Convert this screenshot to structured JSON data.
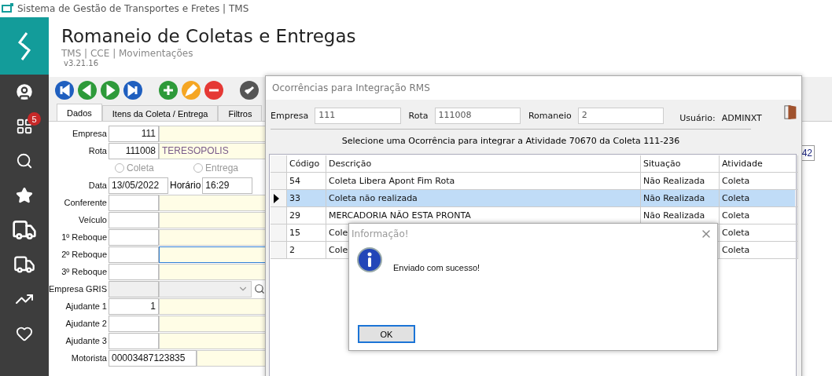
{
  "app_title": "Sistema de Gestão de Transportes e Fretes | TMS",
  "sidebar": {
    "items": [
      {
        "kind": "user"
      },
      {
        "kind": "grid",
        "badge": "5"
      },
      {
        "kind": "search"
      },
      {
        "kind": "star"
      },
      {
        "kind": "truck"
      },
      {
        "kind": "van"
      },
      {
        "kind": "chart"
      },
      {
        "kind": "heart"
      }
    ]
  },
  "header": {
    "title": "Romaneio de Coletas e Entregas",
    "breadcrumb": "TMS | CCE | Movimentações",
    "version": "v3.21.16"
  },
  "toolbar": {
    "buttons": [
      {
        "kind": "first"
      },
      {
        "kind": "prev"
      },
      {
        "kind": "next"
      },
      {
        "kind": "last"
      },
      {
        "kind": "add"
      },
      {
        "kind": "edit"
      },
      {
        "kind": "remove"
      },
      {
        "kind": "confirm"
      }
    ]
  },
  "tabs": [
    {
      "label": "Dados",
      "selected": true
    },
    {
      "label": "Itens da Coleta / Entrega",
      "selected": false
    },
    {
      "label": "Filtros",
      "selected": false
    }
  ],
  "form": {
    "rows": [
      {
        "kind": "lookup",
        "label": "Empresa",
        "code": "111"
      },
      {
        "kind": "lookup",
        "label": "Rota",
        "code": "111008",
        "description": "TERESOPOLIS"
      },
      {
        "kind": "radios",
        "options": [
          {
            "label": "Coleta",
            "checked": false
          },
          {
            "label": "Entrega",
            "checked": false
          }
        ]
      },
      {
        "kind": "datetime",
        "label": "Data",
        "date": "13/05/2022",
        "time_label": "Horário",
        "time": "16:29"
      },
      {
        "kind": "lookup",
        "label": "Conferente"
      },
      {
        "kind": "lookup",
        "label": "Veículo"
      },
      {
        "kind": "lookup",
        "label": "1º Reboque"
      },
      {
        "kind": "lookup",
        "label": "2º Reboque",
        "focused": true
      },
      {
        "kind": "lookup",
        "label": "3º Reboque"
      },
      {
        "kind": "combo",
        "label": "Empresa GRIS",
        "disabled": true
      },
      {
        "kind": "lookup",
        "label": "Ajudante 1",
        "code": "1"
      },
      {
        "kind": "lookup",
        "label": "Ajudante 2"
      },
      {
        "kind": "lookup",
        "label": "Ajudante 3"
      },
      {
        "kind": "wide",
        "label": "Motorista",
        "code": "00003487123835"
      }
    ]
  },
  "side_field": {
    "value": "42"
  },
  "occurrence_window": {
    "title": "Ocorrências para Integração RMS",
    "fields": [
      {
        "label": "Empresa",
        "value": "111"
      },
      {
        "label": "Rota",
        "value": "111008"
      },
      {
        "label": "Romaneio",
        "value": "2"
      }
    ],
    "user_label": "Usuário:",
    "user": "ADMINXT",
    "message": "Selecione uma Ocorrência para integrar a Atividade 70670 da Coleta 111-236",
    "table": {
      "columns": [
        "Código",
        "Descrição",
        "Situação",
        "Atividade"
      ],
      "rows": [
        {
          "code": "54",
          "description": "Coleta Libera Apont Fim Rota",
          "situation": "Não Realizada",
          "activity": "Coleta",
          "selected": false
        },
        {
          "code": "33",
          "description": "Coleta não realizada",
          "situation": "Não Realizada",
          "activity": "Coleta",
          "selected": true
        },
        {
          "code": "29",
          "description": "MERCADORIA NÃO ESTA PRONTA",
          "situation": "Não Realizada",
          "activity": "Coleta",
          "selected": false
        },
        {
          "code": "15",
          "description": "Cole",
          "activity": "Coleta",
          "selected": false
        },
        {
          "code": "2",
          "description": "Cole",
          "activity": "Coleta",
          "selected": false
        }
      ]
    }
  },
  "info_dialog": {
    "title": "Informação!",
    "message": "Enviado com sucesso!",
    "button": "OK"
  }
}
